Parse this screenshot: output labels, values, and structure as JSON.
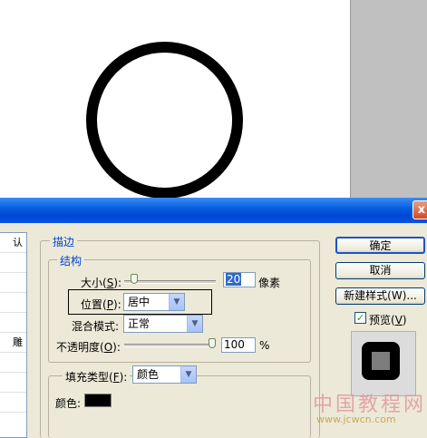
{
  "dialog": {
    "close_label": "x",
    "left_list_items": [
      "认",
      "",
      "",
      "",
      "",
      "雕",
      "",
      "",
      ""
    ]
  },
  "stroke": {
    "group_title": "描边",
    "structure_title": "结构",
    "size_label": "大小(",
    "size_key": "S",
    "size_label_end": "):",
    "size_value": "20",
    "size_unit": "像素",
    "size_level": 0.08,
    "position_label": "位置(",
    "position_key": "P",
    "position_label_end": "):",
    "position_value": "居中",
    "blend_label": "混合模式:",
    "blend_value": "正常",
    "opacity_label": "不透明度(",
    "opacity_key": "O",
    "opacity_label_end": "):",
    "opacity_value": "100",
    "opacity_unit": "%",
    "opacity_level": 1.0,
    "fill_type_label": "填充类型(",
    "fill_type_key": "F",
    "fill_type_label_end": "):",
    "fill_type_value": "颜色",
    "color_label": "颜色:",
    "color_value": "#000000"
  },
  "buttons": {
    "ok": "确定",
    "cancel": "取消",
    "new_style": "新建样式(W)...",
    "preview_label": "预览(",
    "preview_key": "V",
    "preview_label_end": ")",
    "preview_checked": "✓"
  },
  "watermark": {
    "main": "中国教程网",
    "url": "www.jcwcn.com"
  }
}
